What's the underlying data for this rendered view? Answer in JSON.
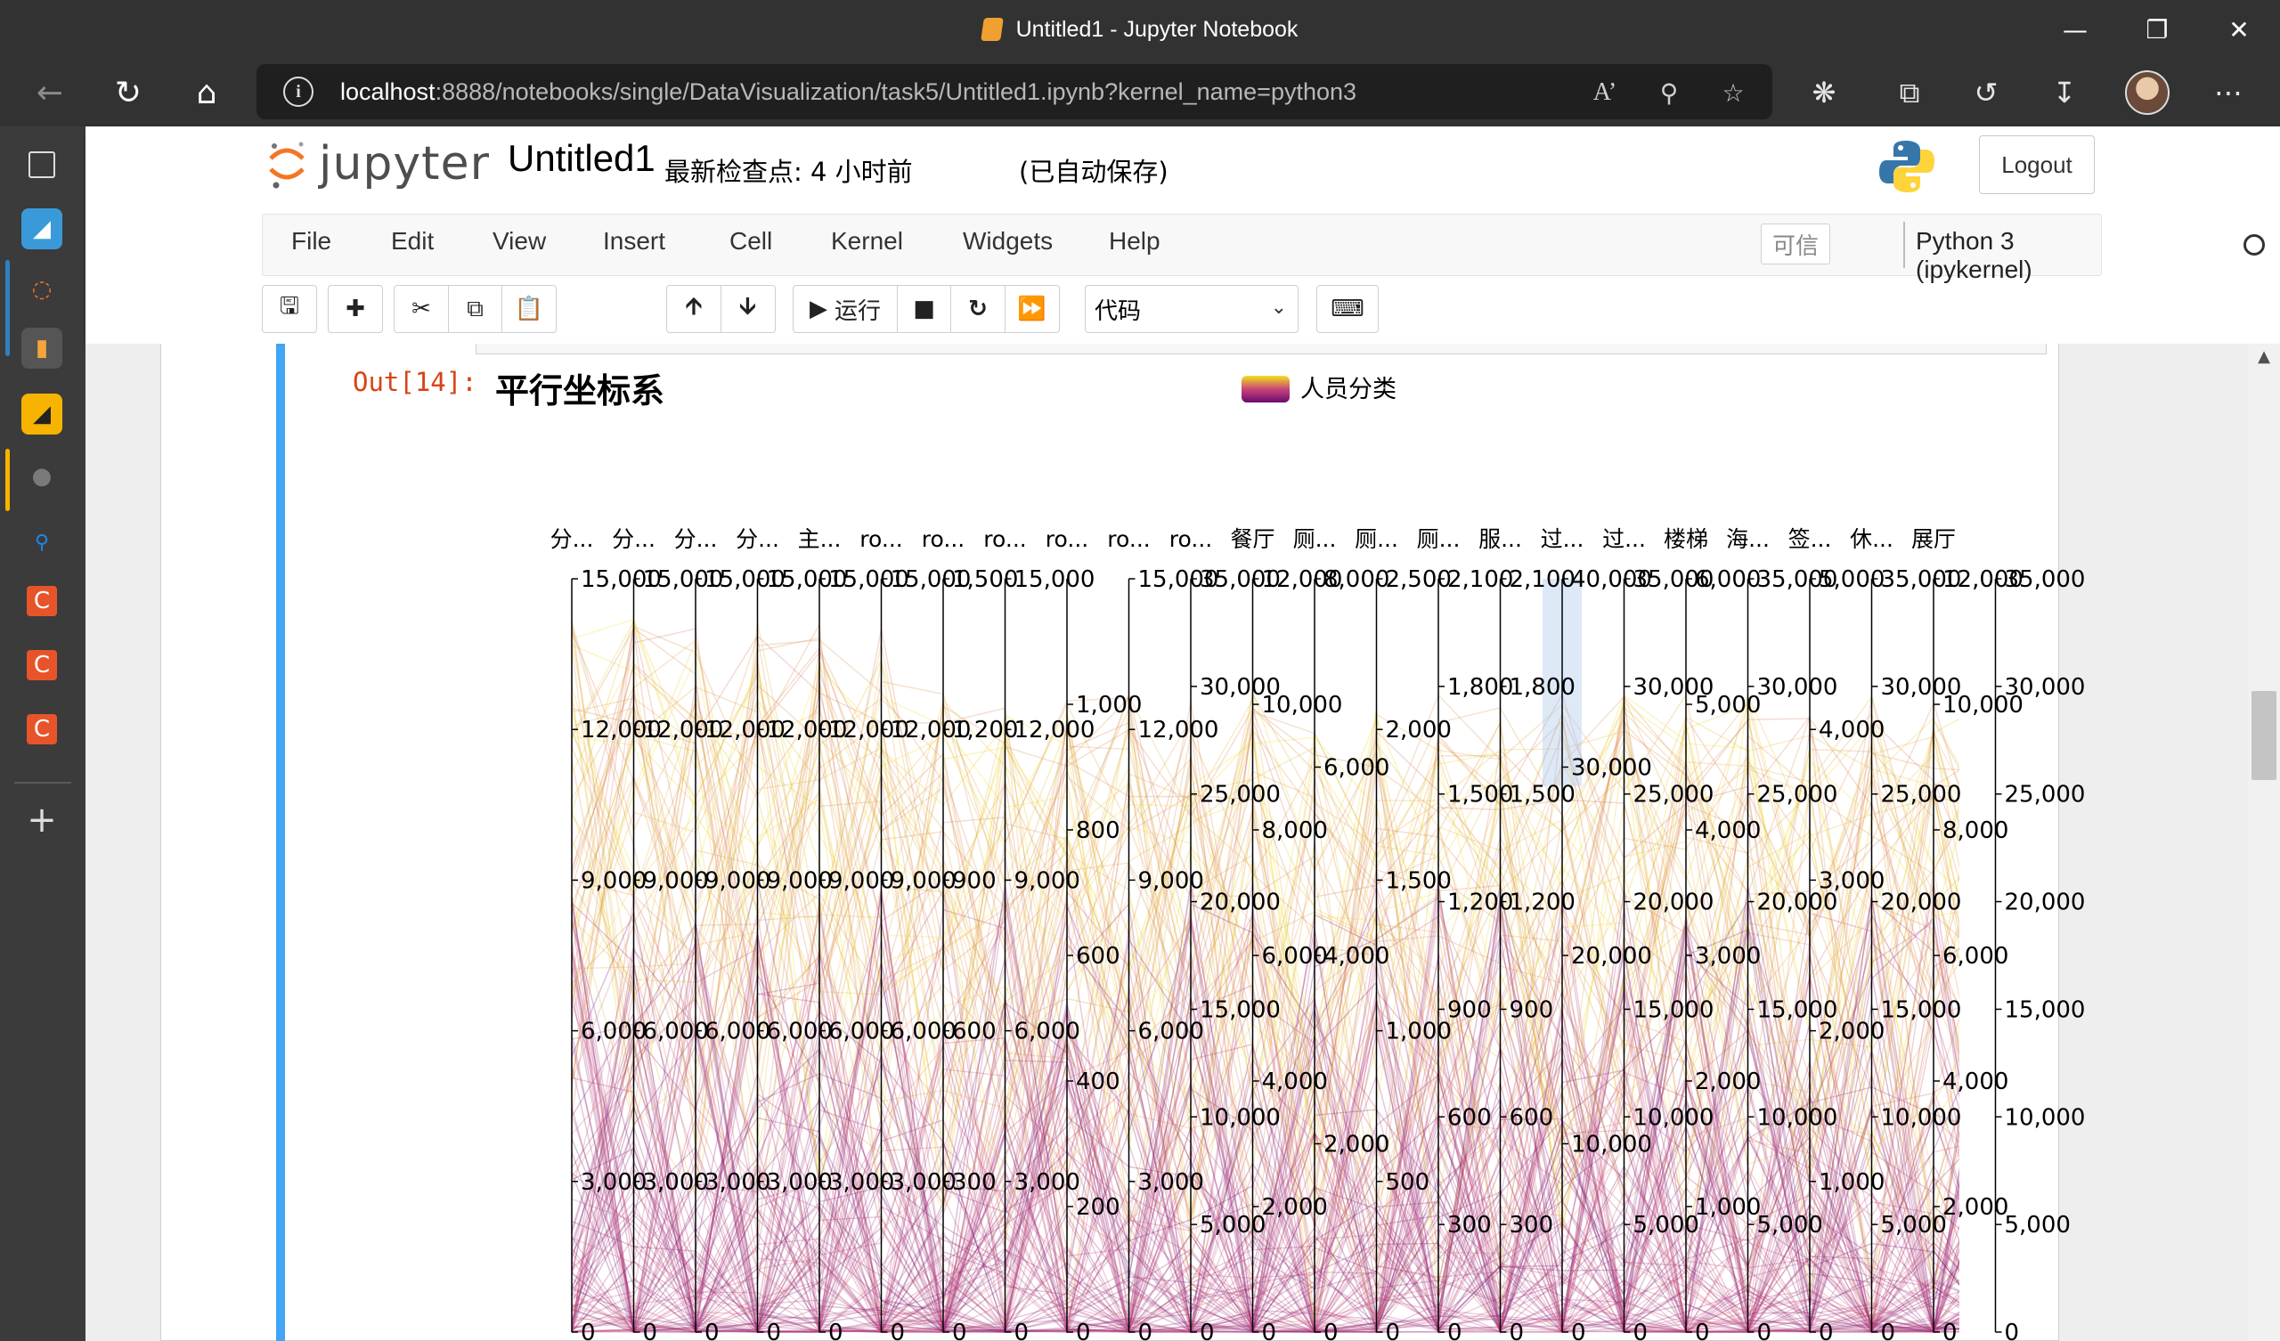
{
  "browser": {
    "window_title": "Untitled1 - Jupyter Notebook",
    "url_host": "localhost",
    "url_path": ":8888/notebooks/single/DataVisualization/task5/Untitled1.ipynb?kernel_name=python3",
    "window_buttons": [
      "minimize",
      "restore",
      "close"
    ]
  },
  "sidebar": {
    "items": [
      "tabs-icon",
      "app-icon",
      "jupyter-icon",
      "notebook-icon",
      "app-icon-2",
      "globe-icon",
      "search-icon",
      "c-app-icon",
      "c-app-icon-2",
      "c-app-icon-3",
      "plus-icon"
    ]
  },
  "jupyter": {
    "logo_text": "jupyter",
    "notebook_name": "Untitled1",
    "checkpoint": "最新检查点: 4 小时前",
    "autosave": "(已自动保存)",
    "logout": "Logout",
    "menu": [
      "File",
      "Edit",
      "View",
      "Insert",
      "Cell",
      "Kernel",
      "Widgets",
      "Help"
    ],
    "trusted": "可信",
    "kernel": "Python 3 (ipykernel)",
    "run_label": "运行",
    "cell_type": "代码"
  },
  "output": {
    "prompt": "Out[14]:"
  },
  "chart_data": {
    "type": "parallel",
    "title": "平行坐标系",
    "legend": {
      "name": "人员分类",
      "colors": [
        "#6a0a6f",
        "#f2e21b"
      ],
      "placement": "top-center"
    },
    "axes": [
      {
        "name": "分...",
        "max": 15000,
        "ticks": [
          "0",
          "3,000",
          "6,000",
          "9,000",
          "12,000",
          "15,000"
        ]
      },
      {
        "name": "分...",
        "max": 15000,
        "ticks": [
          "0",
          "3,000",
          "6,000",
          "9,000",
          "12,000",
          "15,000"
        ]
      },
      {
        "name": "分...",
        "max": 15000,
        "ticks": [
          "0",
          "3,000",
          "6,000",
          "9,000",
          "12,000",
          "15,000"
        ]
      },
      {
        "name": "分...",
        "max": 15000,
        "ticks": [
          "0",
          "3,000",
          "6,000",
          "9,000",
          "12,000",
          "15,000"
        ]
      },
      {
        "name": "主...",
        "max": 15000,
        "ticks": [
          "0",
          "3,000",
          "6,000",
          "9,000",
          "12,000",
          "15,000"
        ]
      },
      {
        "name": "ro...",
        "max": 15000,
        "ticks": [
          "0",
          "3,000",
          "6,000",
          "9,000",
          "12,000",
          "15,000"
        ]
      },
      {
        "name": "ro...",
        "max": 1500,
        "ticks": [
          "0",
          "300",
          "600",
          "900",
          "1,200",
          "1,500"
        ]
      },
      {
        "name": "ro...",
        "max": 15000,
        "ticks": [
          "0",
          "3,000",
          "6,000",
          "9,000",
          "12,000",
          "15,000"
        ]
      },
      {
        "name": "ro...",
        "max": 1200,
        "ticks": [
          "0",
          "200",
          "400",
          "600",
          "800",
          "1,000"
        ]
      },
      {
        "name": "ro...",
        "max": 15000,
        "ticks": [
          "0",
          "3,000",
          "6,000",
          "9,000",
          "12,000",
          "15,000"
        ]
      },
      {
        "name": "ro...",
        "max": 35000,
        "ticks": [
          "0",
          "5,000",
          "10,000",
          "15,000",
          "20,000",
          "25,000",
          "30,000",
          "35,000"
        ]
      },
      {
        "name": "餐厅",
        "max": 12000,
        "ticks": [
          "0",
          "2,000",
          "4,000",
          "6,000",
          "8,000",
          "10,000",
          "12,000"
        ]
      },
      {
        "name": "厕...",
        "max": 8000,
        "ticks": [
          "0",
          "2,000",
          "4,000",
          "6,000",
          "8,000"
        ]
      },
      {
        "name": "厕...",
        "max": 2500,
        "ticks": [
          "0",
          "500",
          "1,000",
          "1,500",
          "2,000",
          "2,500"
        ]
      },
      {
        "name": "厕...",
        "max": 2100,
        "ticks": [
          "0",
          "300",
          "600",
          "900",
          "1,200",
          "1,500",
          "1,800",
          "2,100"
        ]
      },
      {
        "name": "服...",
        "max": 2100,
        "ticks": [
          "0",
          "300",
          "600",
          "900",
          "1,200",
          "1,500",
          "1,800",
          "2,100"
        ]
      },
      {
        "name": "过...",
        "max": 40000,
        "ticks": [
          "0",
          "10,000",
          "20,000",
          "30,000",
          "40,000"
        ]
      },
      {
        "name": "过...",
        "max": 35000,
        "ticks": [
          "0",
          "5,000",
          "10,000",
          "15,000",
          "20,000",
          "25,000",
          "30,000",
          "35,000"
        ]
      },
      {
        "name": "楼梯",
        "max": 6000,
        "ticks": [
          "0",
          "1,000",
          "2,000",
          "3,000",
          "4,000",
          "5,000",
          "6,000"
        ]
      },
      {
        "name": "海...",
        "max": 35000,
        "ticks": [
          "0",
          "5,000",
          "10,000",
          "15,000",
          "20,000",
          "25,000",
          "30,000",
          "35,000"
        ]
      },
      {
        "name": "签...",
        "max": 5000,
        "ticks": [
          "0",
          "1,000",
          "2,000",
          "3,000",
          "4,000",
          "5,000"
        ]
      },
      {
        "name": "休...",
        "max": 35000,
        "ticks": [
          "0",
          "5,000",
          "10,000",
          "15,000",
          "20,000",
          "25,000",
          "30,000",
          "35,000"
        ]
      },
      {
        "name": "展厅",
        "max": 12000,
        "ticks": [
          "0",
          "2,000",
          "4,000",
          "6,000",
          "8,000",
          "10,000",
          "12,000"
        ]
      },
      {
        "name": "",
        "max": 35000,
        "ticks": [
          "0",
          "5,000",
          "10,000",
          "15,000",
          "20,000",
          "25,000",
          "30,000",
          "35,000"
        ]
      }
    ],
    "brush": {
      "axis_index": 16,
      "range": [
        29000,
        40000
      ]
    }
  }
}
